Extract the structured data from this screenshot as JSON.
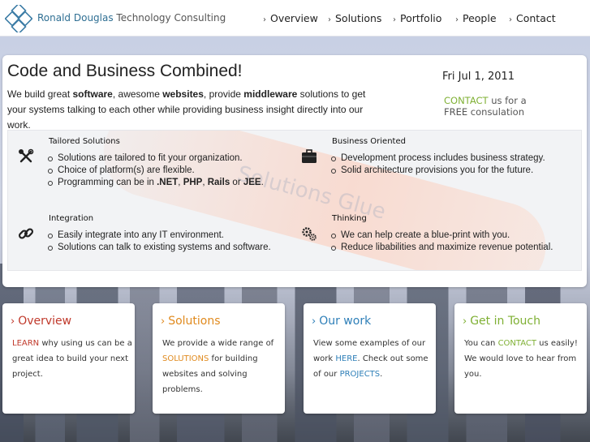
{
  "header": {
    "brand_part1": "Ronald Douglas",
    "brand_part2": " Technology Consulting",
    "nav": [
      "Overview",
      "Solutions",
      "Portfolio",
      "People",
      "Contact"
    ]
  },
  "main": {
    "headline": "Code and Business Combined!",
    "intro_1": "We build great ",
    "intro_software": "software",
    "intro_2": ", awesome ",
    "intro_websites": "websites",
    "intro_3": ", provide ",
    "intro_middleware": "middleware",
    "intro_4": " solutions to get your systems talking to each other while providing business insight directly into our work.",
    "date": "Fri Jul 1, 2011",
    "cta_contact": "CONTACT",
    "cta_1": " us for a",
    "cta_2": "FREE consulation"
  },
  "watermark": {
    "text": "Solutions Glue"
  },
  "features": {
    "tailored": {
      "title": "Tailored Solutions",
      "icon": "tools-icon",
      "items": [
        "Solutions are tailored to fit your organization.",
        "Choice of platform(s) are flexible."
      ],
      "item3_prefix": "Programming can be in ",
      "item3_net": ".NET",
      "item3_sep1": ", ",
      "item3_php": "PHP",
      "item3_sep2": ", ",
      "item3_rails": "Rails",
      "item3_or": " or ",
      "item3_jee": "JEE",
      "item3_end": "."
    },
    "business": {
      "title": "Business Oriented",
      "icon": "briefcase-icon",
      "items": [
        "Development process includes business strategy.",
        "Solid architecture provisions you for the future."
      ]
    },
    "integration": {
      "title": "Integration",
      "icon": "link-icon",
      "items": [
        "Easily integrate into any IT environment.",
        "Solutions can talk to existing systems and software."
      ]
    },
    "thinking": {
      "title": "Thinking",
      "icon": "gears-icon",
      "items": [
        "We can help create a blue-print with you.",
        "Reduce libabilities and maximize revenue potential."
      ]
    }
  },
  "cards": {
    "overview": {
      "title": "Overview",
      "learn": "LEARN",
      "text": " why using us can be a great idea to build your next project."
    },
    "solutions": {
      "title": "Solutions",
      "text1": "We provide a wide range of ",
      "solutions": "SOLUTIONS",
      "text2": " for building websites and solving problems."
    },
    "work": {
      "title": "Our work",
      "text1": "View some examples of our work ",
      "here": "HERE",
      "text2": ". Check out some of our ",
      "projects": "PROJECTS",
      "text3": "."
    },
    "touch": {
      "title": "Get in Touch",
      "text1": "You can ",
      "contact": "CONTACT",
      "text2": " us easily! We would love to hear from you."
    }
  },
  "colors": {
    "red": "#c0392b",
    "orange": "#e08a1e",
    "blue": "#2e7fb8",
    "green": "#7fb034",
    "brand": "#2f6f93"
  }
}
